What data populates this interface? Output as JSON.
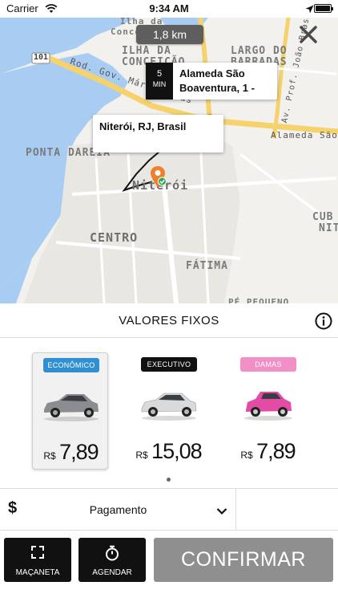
{
  "status_bar": {
    "carrier": "Carrier",
    "time": "9:34 AM"
  },
  "map": {
    "distance": "1,8 km",
    "destination_card": {
      "eta_value": "5",
      "eta_unit": "MIN",
      "address_line1": "Alameda São",
      "address_line2": "Boaventura, 1 -"
    },
    "origin_card": {
      "address": "Niterói, RJ, Brasil"
    },
    "labels": {
      "ilha_1": "Ilha da",
      "ilha_2": "Conceição",
      "ilha_3": "ILHA DA",
      "ilha_4": "CONCEIÇÃO",
      "largo_1": "LARGO DO",
      "largo_2": "BARRADAS",
      "road_shield": "101",
      "rod_gov": "Rod. Gov. Mário Covas",
      "av_prof": "Av. Prof. João Brasil",
      "alameda": "Alameda São Bo",
      "ponta_dareia": "PONTA DAREIA",
      "niteroi": "Niterói",
      "centro": "CENTRO",
      "cubango_1": "CUB",
      "cubango_2": "NIT",
      "fatima": "FÁTIMA",
      "pe_pequeno": "PÉ PEQUENO"
    }
  },
  "fixed_values": {
    "title": "VALORES FIXOS"
  },
  "cars": [
    {
      "badge": "ECONÔMICO",
      "badge_color": "#2f8fd1",
      "currency": "R$",
      "price": "7,89",
      "body_color": "#8a8c8f",
      "selected": true
    },
    {
      "badge": "EXECUTIVO",
      "badge_color": "#111111",
      "currency": "R$",
      "price": "15,08",
      "body_color": "#d9dadc",
      "selected": false
    },
    {
      "badge": "DAMAS",
      "badge_color": "#f28fc6",
      "currency": "R$",
      "price": "7,89",
      "body_color": "#e34ca5",
      "selected": false
    }
  ],
  "payment": {
    "icon": "$",
    "label": "Pagamento"
  },
  "actions": {
    "door_label": "MAÇANETA",
    "schedule_label": "AGENDAR",
    "confirm_label": "CONFIRMAR"
  }
}
